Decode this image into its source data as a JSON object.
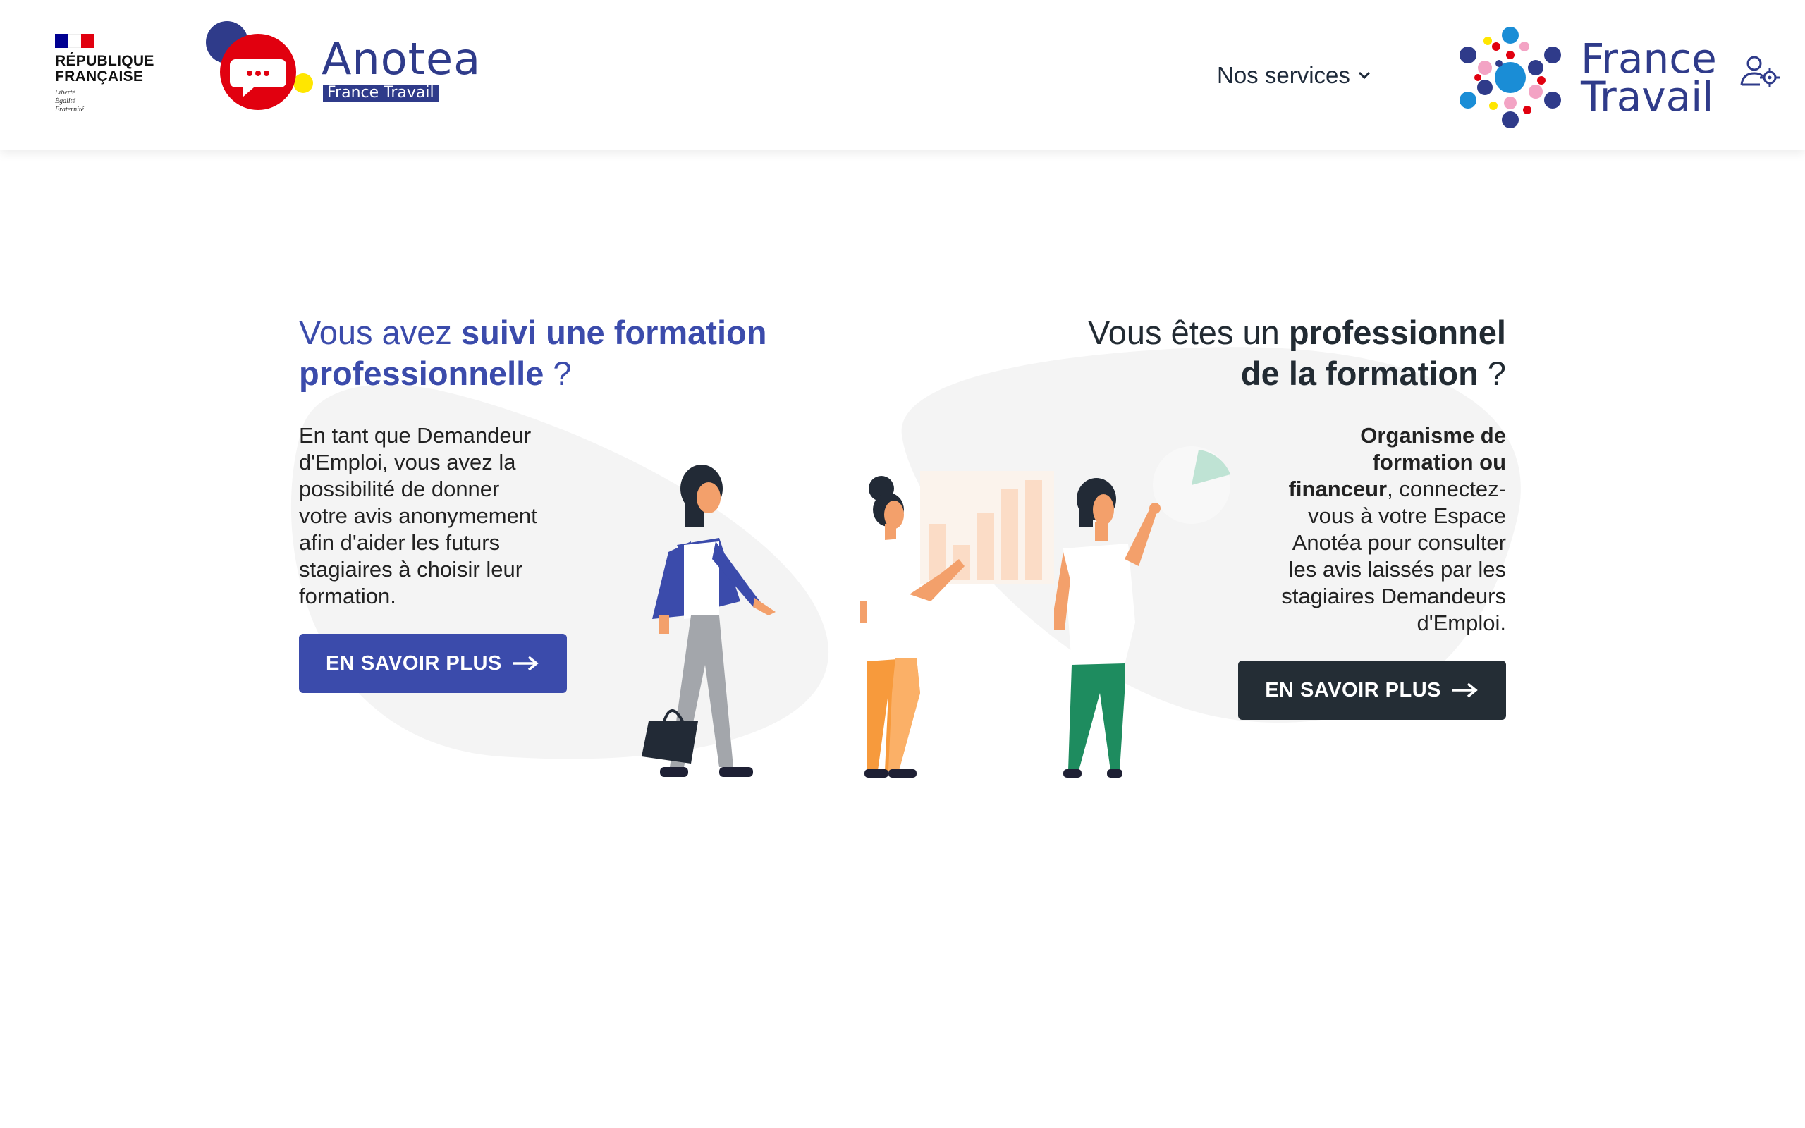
{
  "header": {
    "marianne": {
      "title": "RÉPUBLIQUE\nFRANÇAISE",
      "motto": "Liberté\nÉgalité\nFraternité",
      "flag_colors": [
        "#000091",
        "#ffffff",
        "#e1000f"
      ]
    },
    "anotea": {
      "name": "Anotea",
      "tagline": "France Travail",
      "icon": "speech-bubble-icon"
    },
    "nav": {
      "services_label": "Nos services",
      "chevron": "chevron-down-icon"
    },
    "france_travail": {
      "name": "France\nTravail"
    },
    "user_icon": "user-settings-icon"
  },
  "stagiaire": {
    "heading_prefix": "Vous avez ",
    "heading_strong": "suivi une formation professionnelle",
    "heading_suffix": " ?",
    "text": "En tant que Demandeur d'Emploi, vous avez la possibilité de donner votre avis anonymement afin d'aider les futurs stagiaires à choisir leur formation.",
    "button_label": "EN SAVOIR PLUS"
  },
  "professionnel": {
    "heading_prefix": "Vous êtes un ",
    "heading_strong": "professionnel de la formation",
    "heading_suffix": " ?",
    "text_strong": "Organisme de formation ou financeur",
    "text_rest": ", connectez-vous à votre Espace Anotéa pour consulter les avis laissés par les stagiaires Demandeurs d'Emploi.",
    "button_label": "EN SAVOIR PLUS"
  },
  "colors": {
    "primary_blue": "#3b4bab",
    "dark": "#242d35",
    "anotea_red": "#e1000f",
    "anotea_navy": "#2f3b8a",
    "accent_yellow": "#ffe600"
  }
}
